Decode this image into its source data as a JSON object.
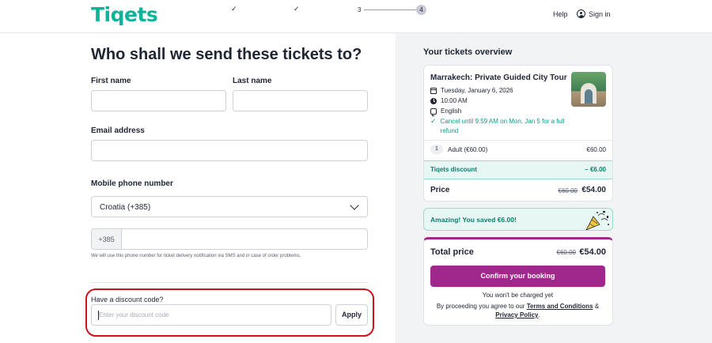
{
  "header": {
    "logo": "Tiqets",
    "steps": {
      "check1": "✓",
      "check2": "✓",
      "step3": "3",
      "step4": "4"
    },
    "help": "Help",
    "signin": "Sign in"
  },
  "form": {
    "title": "Who shall we send these tickets to?",
    "first_name_label": "First name",
    "last_name_label": "Last name",
    "email_label": "Email address",
    "phone_label": "Mobile phone number",
    "country_value": "Croatia (+385)",
    "phone_prefix": "+385",
    "phone_hint": "We will use this phone number for ticket delivery notification via SMS and in case of order problems.",
    "discount_label": "Have a discount code?",
    "discount_placeholder": "Enter your discount code",
    "apply_label": "Apply"
  },
  "overview": {
    "title": "Your tickets overview",
    "tour_title": "Marrakech: Private Guided City Tour",
    "date": "Tuesday, January 6, 2026",
    "time": "10:00 AM",
    "language": "English",
    "cancellation": "Cancel until 9:59 AM on Mon, Jan 5 for a full refund",
    "quantity": "1",
    "ticket_type": "Adult (€60.00)",
    "ticket_price": "€60.00",
    "discount_label": "Tiqets discount",
    "discount_value": "– €6.00",
    "price_label": "Price",
    "price_old": "€60.00",
    "price_new": "€54.00",
    "saved_text": "Amazing! You saved €6.00!"
  },
  "total": {
    "label": "Total price",
    "old": "€60.00",
    "new": "€54.00",
    "confirm_label": "Confirm your booking",
    "not_charged": "You won't be charged yet",
    "agree_prefix": "By proceeding you agree to our",
    "terms_link": "Terms and Conditions",
    "amp": "&",
    "privacy_link": "Privacy Policy",
    "period": "."
  },
  "colors": {
    "brand": "#10b39a",
    "accent": "#a0278c",
    "highlight": "#d1111d",
    "success": "#0b9d86"
  }
}
